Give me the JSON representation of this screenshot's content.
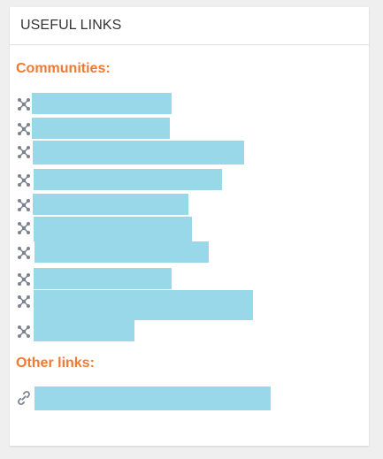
{
  "card": {
    "title": "USEFUL LINKS"
  },
  "sections": {
    "communities_label": "Communities:",
    "other_links_label": "Other links:"
  },
  "communities": [
    {
      "label": "",
      "icon": "community-network-icon",
      "redacted": true
    },
    {
      "label": "",
      "icon": "community-network-icon",
      "redacted": true
    },
    {
      "label": "",
      "icon": "community-network-icon",
      "redacted": true
    },
    {
      "label": "",
      "icon": "community-network-icon",
      "redacted": true
    },
    {
      "label": "",
      "icon": "community-network-icon",
      "redacted": true
    },
    {
      "label": "",
      "icon": "community-network-icon",
      "redacted": true
    },
    {
      "label": "",
      "icon": "community-network-icon",
      "redacted": true
    },
    {
      "label": "",
      "icon": "community-network-icon",
      "redacted": true
    },
    {
      "label": "",
      "icon": "community-network-icon",
      "redacted": true
    },
    {
      "label": "",
      "icon": "community-network-icon",
      "redacted": true
    }
  ],
  "other_links": [
    {
      "label": "",
      "icon": "link-chain-icon",
      "redacted": true
    }
  ],
  "colors": {
    "accent": "#ef7a34",
    "redaction": "#99d8e8",
    "icon": "#7b838e"
  }
}
